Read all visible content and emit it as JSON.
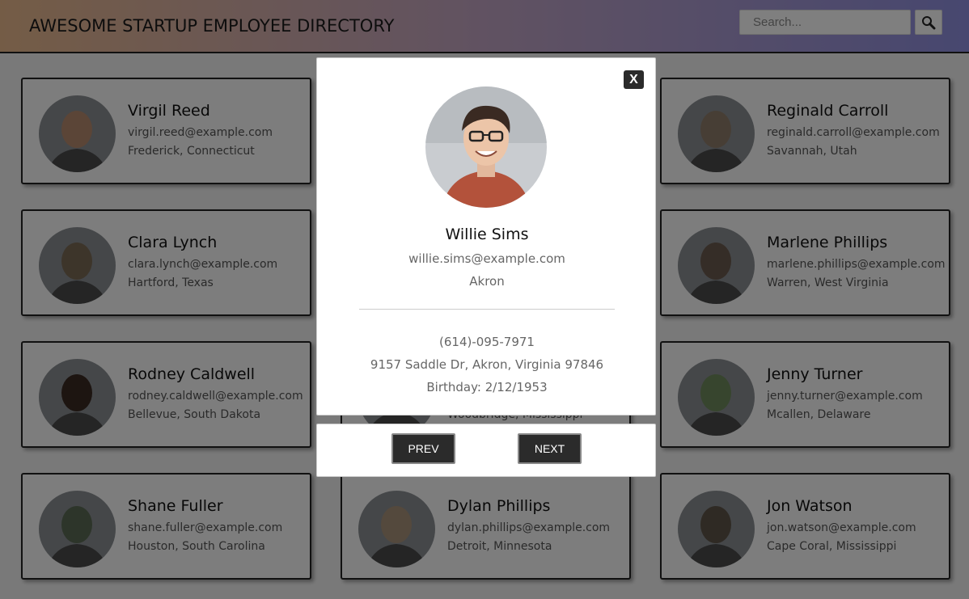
{
  "header": {
    "title": "AWESOME STARTUP EMPLOYEE DIRECTORY",
    "search_placeholder": "Search..."
  },
  "cards": [
    {
      "name": "Virgil Reed",
      "email": "virgil.reed@example.com",
      "location": "Frederick, Connecticut",
      "avatar_color": "#b78a6f"
    },
    {
      "name": "",
      "email": "",
      "location": "",
      "avatar_color": "#999999"
    },
    {
      "name": "Reginald Carroll",
      "email": "reginald.carroll@example.com",
      "location": "Savannah, Utah",
      "avatar_color": "#8f7d6b"
    },
    {
      "name": "Clara Lynch",
      "email": "clara.lynch@example.com",
      "location": "Hartford, Texas",
      "avatar_color": "#7a6a55"
    },
    {
      "name": "",
      "email": "",
      "location": "",
      "avatar_color": "#999999"
    },
    {
      "name": "Marlene Phillips",
      "email": "marlene.phillips@example.com",
      "location": "Warren, West Virginia",
      "avatar_color": "#6b5a4e"
    },
    {
      "name": "Rodney Caldwell",
      "email": "rodney.caldwell@example.com",
      "location": "Bellevue, South Dakota",
      "avatar_color": "#3a2a22"
    },
    {
      "name": "",
      "email": "",
      "location": "Woodbridge, Mississippi",
      "avatar_color": "#c98a55"
    },
    {
      "name": "Jenny Turner",
      "email": "jenny.turner@example.com",
      "location": "Mcallen, Delaware",
      "avatar_color": "#6f8a5c"
    },
    {
      "name": "Shane Fuller",
      "email": "shane.fuller@example.com",
      "location": "Houston, South Carolina",
      "avatar_color": "#5b6b55"
    },
    {
      "name": "Dylan Phillips",
      "email": "dylan.phillips@example.com",
      "location": "Detroit, Minnesota",
      "avatar_color": "#a9937a"
    },
    {
      "name": "Jon Watson",
      "email": "jon.watson@example.com",
      "location": "Cape Coral, Mississippi",
      "avatar_color": "#5e5548"
    }
  ],
  "modal": {
    "close_label": "X",
    "name": "Willie Sims",
    "email": "willie.sims@example.com",
    "city": "Akron",
    "phone": "(614)-095-7971",
    "address": "9157 Saddle Dr, Akron, Virginia 97846",
    "birthday": "Birthday: 2/12/1953",
    "avatar_color": "#9a7f72"
  },
  "nav": {
    "prev_label": "PREV",
    "next_label": "NEXT"
  }
}
